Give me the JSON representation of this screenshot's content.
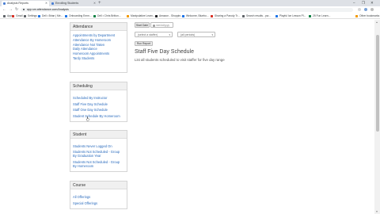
{
  "browser": {
    "tabs": [
      {
        "title": "Analysis Reports",
        "active": true,
        "color": "#4a7fd4"
      },
      {
        "title": "Enrolling Students",
        "active": false,
        "color": "#4a7fd4"
      }
    ],
    "new_tab": "+",
    "window_controls": [
      "–",
      "❐",
      "✕"
    ],
    "nav": {
      "back": "←",
      "forward": "→",
      "reload": "↻"
    },
    "url": "app.sm.attendance.com/Analysis",
    "bookmarks": [
      {
        "label": "Apps",
        "color": "#5f6368"
      },
      {
        "label": "Gmail",
        "color": "#d93025"
      },
      {
        "label": "Settings",
        "color": "#5f6368"
      },
      {
        "label": "Dell • Brian | Me...",
        "color": "#1a73e8"
      },
      {
        "label": "Onboarding Emm...",
        "color": "#1a73e8"
      },
      {
        "label": "Dell • Chris Britton...",
        "color": "#0b8043"
      },
      {
        "label": "Manipulative Learn...",
        "color": "#f29900"
      },
      {
        "label": "Amazon - Shoppin...",
        "color": "#202124"
      },
      {
        "label": "Welcome, Bluebo...",
        "color": "#1a73e8"
      },
      {
        "label": "Sharing a Parody Tr...",
        "color": "#d93025"
      },
      {
        "label": "Search results - pw...",
        "color": "#5f6368"
      },
      {
        "label": "Playful Ice Lesson Pl...",
        "color": "#1a73e8"
      },
      {
        "label": "25 Fun Learn...",
        "color": "#0b8043"
      },
      {
        "label": "Other bookmarks",
        "color": "#f29900"
      }
    ]
  },
  "sidebar": {
    "attendance": {
      "heading": "Attendance",
      "links": [
        "Appointments by Department",
        "Attendance By Homeroom",
        "Attendance Not Taken",
        "Daily Attendance",
        "Homeroom Appointments",
        "Tardy Students"
      ]
    },
    "scheduling": {
      "heading": "Scheduling",
      "links": [
        "Scheduled By Instructor",
        "Staff Five Day Schedule",
        "Staff One Day Schedule",
        "Student Schedule By Homeroom"
      ]
    },
    "student": {
      "heading": "Student",
      "links": [
        "Students Never Logged On",
        "Students Not Scheduled - Group By Graduation Year",
        "Students Not Scheduled - Group By Homeroom"
      ]
    },
    "course": {
      "heading": "Course",
      "links": [
        "All Offerings",
        "Special Offerings"
      ]
    }
  },
  "main": {
    "start_date_label": "Start Date",
    "start_date_value": "mm/dd/yyyy",
    "staff_select": "(select a staffer)",
    "period_select": "(all periods)",
    "run_button": "Run Report",
    "title": "Staff Five Day Schedule",
    "subtitle": "List all students scheduled to visit staffer for five day range"
  },
  "colors": {
    "link": "#2a6bbd",
    "panel_header": "#f0f0f0"
  }
}
